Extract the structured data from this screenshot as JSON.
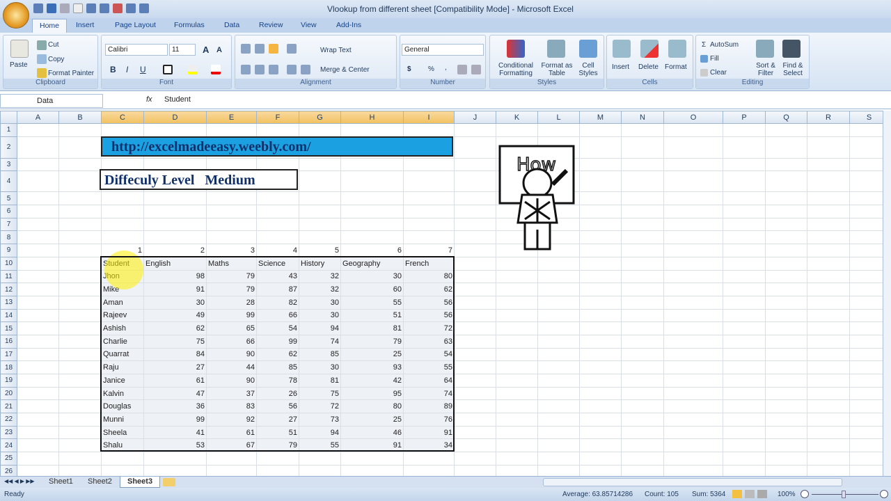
{
  "window": {
    "title": "Vlookup from different sheet  [Compatibility Mode] - Microsoft Excel"
  },
  "tabs": [
    "Home",
    "Insert",
    "Page Layout",
    "Formulas",
    "Data",
    "Review",
    "View",
    "Add-Ins"
  ],
  "ribbon": {
    "clipboard": {
      "label": "Clipboard",
      "paste": "Paste",
      "cut": "Cut",
      "copy": "Copy",
      "format_painter": "Format Painter"
    },
    "font": {
      "label": "Font",
      "name": "Calibri",
      "size": "11",
      "bold": "B",
      "italic": "I",
      "underline": "U"
    },
    "alignment": {
      "label": "Alignment",
      "wrap": "Wrap Text",
      "merge": "Merge & Center"
    },
    "number": {
      "label": "Number",
      "format": "General",
      "currency": "$",
      "percent": "%",
      "comma": ","
    },
    "styles": {
      "label": "Styles",
      "conditional": "Conditional Formatting",
      "format_table": "Format as Table",
      "cell_styles": "Cell Styles"
    },
    "cells": {
      "label": "Cells",
      "insert": "Insert",
      "delete": "Delete",
      "format": "Format"
    },
    "editing": {
      "label": "Editing",
      "autosum": "AutoSum",
      "fill": "Fill",
      "clear": "Clear",
      "sort": "Sort & Filter",
      "find": "Find & Select"
    }
  },
  "formula_bar": {
    "name_box": "Data",
    "fx": "fx",
    "value": "Student"
  },
  "columns": [
    "A",
    "B",
    "C",
    "D",
    "E",
    "F",
    "G",
    "H",
    "I",
    "J",
    "K",
    "L",
    "M",
    "N",
    "O",
    "P",
    "Q",
    "R",
    "S"
  ],
  "link": "http://excelmadeeasy.weebly.com/",
  "difficulty": "Diffeculy Level   Medium",
  "index_numbers": [
    "1",
    "2",
    "3",
    "4",
    "5",
    "6",
    "7"
  ],
  "table": {
    "headers": [
      "Student",
      "English",
      "Maths",
      "Science",
      "History",
      "Geography",
      "French"
    ],
    "rows": [
      [
        "Jhon",
        "98",
        "79",
        "43",
        "32",
        "30",
        "80"
      ],
      [
        "Mike",
        "91",
        "79",
        "87",
        "32",
        "60",
        "62"
      ],
      [
        "Aman",
        "30",
        "28",
        "82",
        "30",
        "55",
        "56"
      ],
      [
        "Rajeev",
        "49",
        "99",
        "66",
        "30",
        "51",
        "56"
      ],
      [
        "Ashish",
        "62",
        "65",
        "54",
        "94",
        "81",
        "72"
      ],
      [
        "Charlie",
        "75",
        "66",
        "99",
        "74",
        "79",
        "63"
      ],
      [
        "Quarrat",
        "84",
        "90",
        "62",
        "85",
        "25",
        "54"
      ],
      [
        "Raju",
        "27",
        "44",
        "85",
        "30",
        "93",
        "55"
      ],
      [
        "Janice",
        "61",
        "90",
        "78",
        "81",
        "42",
        "64"
      ],
      [
        "Kalvin",
        "47",
        "37",
        "26",
        "75",
        "95",
        "74"
      ],
      [
        "Douglas",
        "36",
        "83",
        "56",
        "72",
        "80",
        "89"
      ],
      [
        "Munni",
        "99",
        "92",
        "27",
        "73",
        "25",
        "76"
      ],
      [
        "Sheela",
        "41",
        "61",
        "51",
        "94",
        "46",
        "91"
      ],
      [
        "Shalu",
        "53",
        "67",
        "79",
        "55",
        "91",
        "34"
      ]
    ]
  },
  "image_text": "How",
  "sheets": [
    "Sheet1",
    "Sheet2",
    "Sheet3"
  ],
  "status": {
    "ready": "Ready",
    "average": "Average: 63.85714286",
    "count": "Count: 105",
    "sum": "Sum: 5364",
    "zoom": "100%"
  }
}
